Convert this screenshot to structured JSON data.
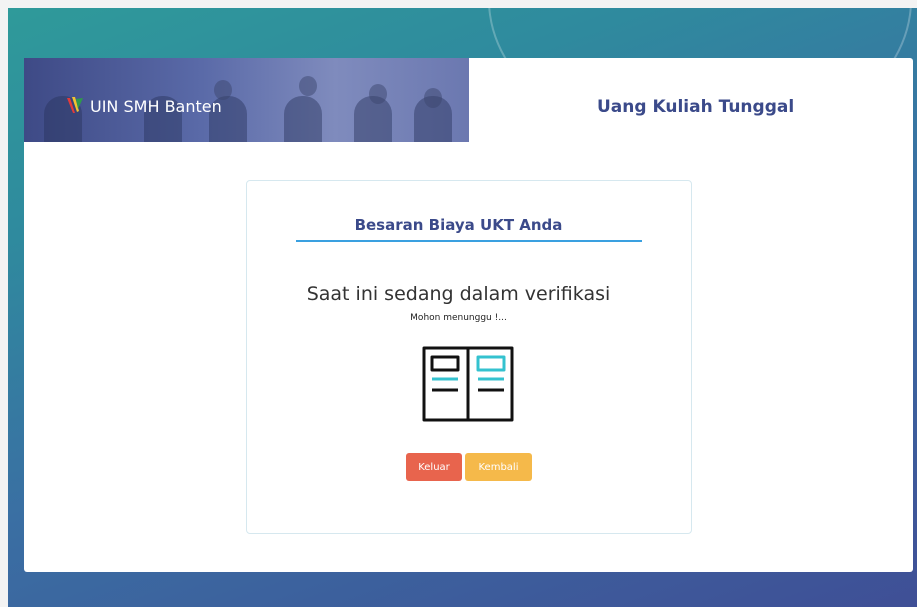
{
  "header": {
    "brand": "UIN SMH Banten",
    "site_title": "Uang Kuliah Tunggal"
  },
  "panel": {
    "heading": "Besaran Biaya UKT Anda",
    "status_title": "Saat ini sedang dalam verifikasi",
    "status_subtitle": "Mohon menunggu !...",
    "illustration_icon": "open-book-icon"
  },
  "actions": {
    "exit_label": "Keluar",
    "back_label": "Kembali"
  },
  "colors": {
    "accent": "#3b4a8a",
    "underline": "#3aa0e0",
    "exit": "#e8644d",
    "back": "#f5b94a",
    "book_accent": "#34c2cf"
  }
}
